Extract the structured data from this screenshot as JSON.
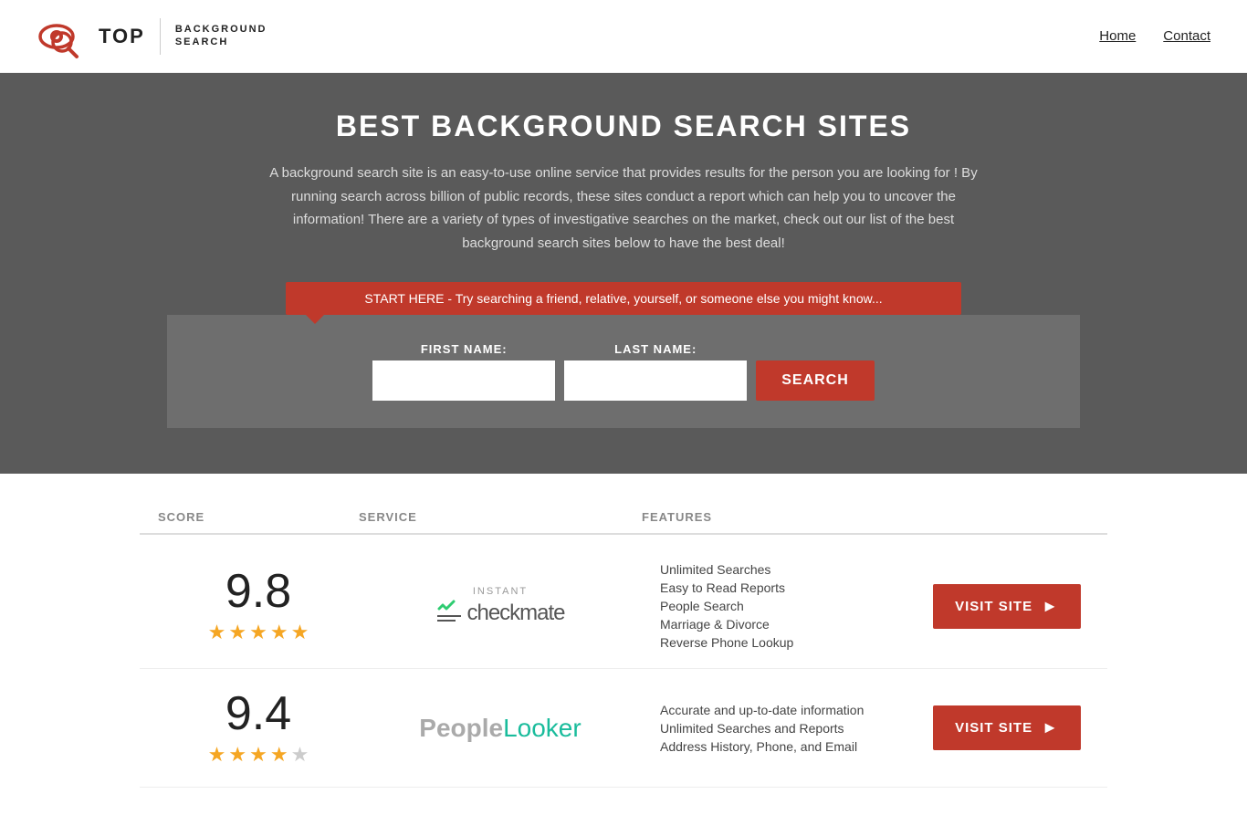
{
  "header": {
    "logo_top": "TOP",
    "logo_sub_line1": "BACKGROUND",
    "logo_sub_line2": "SEARCH",
    "nav": [
      {
        "label": "Home",
        "href": "#"
      },
      {
        "label": "Contact",
        "href": "#"
      }
    ]
  },
  "hero": {
    "title": "BEST BACKGROUND SEARCH SITES",
    "description": "A background search site is an easy-to-use online service that provides results  for the person you are looking for ! By  running  search across billion of public records, these sites conduct  a report which can help you to uncover the information! There are a variety of types of investigative searches on the market, check out our  list of the best background search sites below to have the best deal!"
  },
  "search": {
    "banner_text": "START HERE - Try searching a friend, relative, yourself, or someone else you might know...",
    "first_name_label": "FIRST NAME:",
    "last_name_label": "LAST NAME:",
    "button_label": "SEARCH"
  },
  "table": {
    "headers": [
      "SCORE",
      "SERVICE",
      "FEATURES",
      ""
    ],
    "rows": [
      {
        "score": "9.8",
        "stars": 5,
        "service_name": "Instant Checkmate",
        "features": [
          "Unlimited Searches",
          "Easy to Read Reports",
          "People Search",
          "Marriage & Divorce",
          "Reverse Phone Lookup"
        ],
        "visit_label": "VISIT SITE"
      },
      {
        "score": "9.4",
        "stars": 4,
        "service_name": "PeopleLooker",
        "features": [
          "Accurate and up-to-date information",
          "Unlimited Searches and Reports",
          "Address History, Phone, and Email"
        ],
        "visit_label": "VISIT SITE"
      }
    ]
  }
}
